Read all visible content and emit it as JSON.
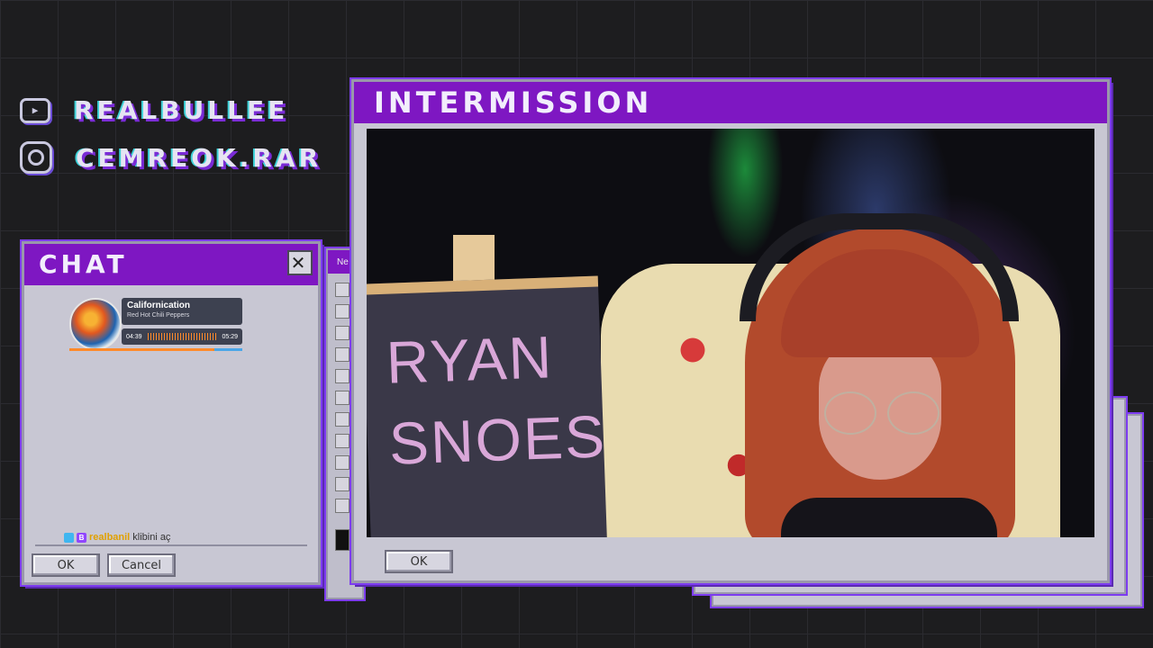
{
  "socials": [
    {
      "icon": "youtube-icon",
      "handle": "REALBULLEE"
    },
    {
      "icon": "instagram-icon",
      "handle": "CEMREOK.RAR"
    }
  ],
  "chat_window": {
    "title": "CHAT",
    "close_label": "✕",
    "now_playing": {
      "song": "Californication",
      "artist": "Red Hot Chili Peppers",
      "elapsed": "04:39",
      "duration": "05:29",
      "progress": 0.84
    },
    "message": {
      "user": "realbanil",
      "text": "klibini aç"
    },
    "ok_label": "OK",
    "cancel_label": "Cancel"
  },
  "paint_window": {
    "title_fragment": "Ne"
  },
  "main_window": {
    "title": "INTERMISSION",
    "board_line1": "RYAN",
    "board_line2": "SNOES",
    "ok_label": "OK"
  },
  "colors": {
    "titlebar": "#7e17c2",
    "accent_border": "#7d3cf0",
    "window_bg": "#c8c7d3"
  }
}
